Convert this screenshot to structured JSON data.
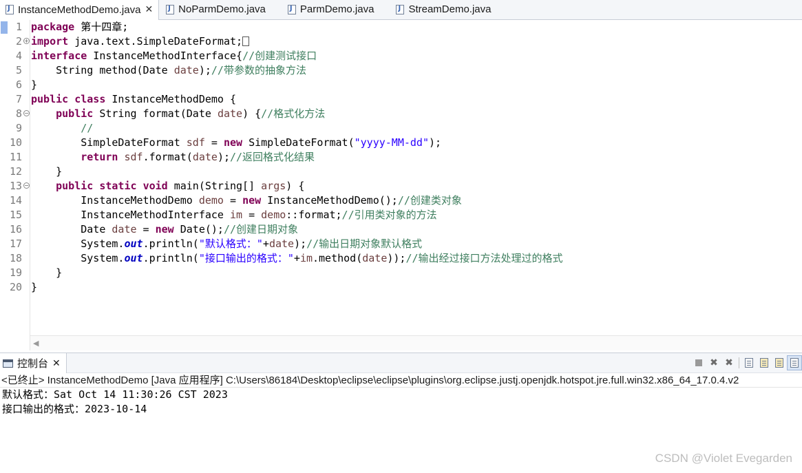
{
  "editor_tabs": [
    {
      "label": "InstanceMethodDemo.java",
      "active": true
    },
    {
      "label": "NoParmDemo.java",
      "active": false
    },
    {
      "label": "ParmDemo.java",
      "active": false
    },
    {
      "label": "StreamDemo.java",
      "active": false
    }
  ],
  "line_numbers": [
    "1",
    "2",
    "4",
    "5",
    "6",
    "7",
    "8",
    "9",
    "10",
    "11",
    "12",
    "13",
    "14",
    "15",
    "16",
    "17",
    "18",
    "19",
    "20"
  ],
  "code": {
    "l1": [
      "package",
      " 第十四章;"
    ],
    "l2": [
      "import",
      " java.text.SimpleDateFormat;"
    ],
    "l4": [
      "interface",
      " InstanceMethodInterface{",
      "//创建测试接口"
    ],
    "l5": [
      "    String method(Date ",
      "date",
      ");",
      "//带参数的抽象方法"
    ],
    "l6": [
      "}"
    ],
    "l7": [
      "public",
      " ",
      "class",
      " InstanceMethodDemo {"
    ],
    "l8": [
      "    ",
      "public",
      " String format(Date ",
      "date",
      ") {",
      "//格式化方法"
    ],
    "l9": [
      "        ",
      "//"
    ],
    "l10": [
      "        SimpleDateFormat ",
      "sdf",
      " = ",
      "new",
      " SimpleDateFormat(",
      "\"yyyy-MM-dd\"",
      ");"
    ],
    "l11": [
      "        ",
      "return",
      " ",
      "sdf",
      ".format(",
      "date",
      ");",
      "//返回格式化结果"
    ],
    "l12": [
      "    }"
    ],
    "l13": [
      "    ",
      "public",
      " ",
      "static",
      " ",
      "void",
      " main(String[] ",
      "args",
      ") {"
    ],
    "l14": [
      "        InstanceMethodDemo ",
      "demo",
      " = ",
      "new",
      " InstanceMethodDemo();",
      "//创建类对象"
    ],
    "l15": [
      "        InstanceMethodInterface ",
      "im",
      " = ",
      "demo",
      "::format;",
      "//引用类对象的方法"
    ],
    "l16": [
      "        Date ",
      "date",
      " = ",
      "new",
      " Date();",
      "//创建日期对象"
    ],
    "l17": [
      "        System.",
      "out",
      ".println(",
      "\"默认格式：\"",
      "+",
      "date",
      ");",
      "//输出日期对象默认格式"
    ],
    "l18": [
      "        System.",
      "out",
      ".println(",
      "\"接口输出的格式：\"",
      "+",
      "im",
      ".method(",
      "date",
      "));",
      "//输出经过接口方法处理过的格式"
    ],
    "l19": [
      "    }"
    ],
    "l20": [
      "}"
    ]
  },
  "console": {
    "tab_label": "控制台",
    "header": "<已终止> InstanceMethodDemo [Java 应用程序] C:\\Users\\86184\\Desktop\\eclipse\\eclipse\\plugins\\org.eclipse.justj.openjdk.hotspot.jre.full.win32.x86_64_17.0.4.v2",
    "output": [
      "默认格式：Sat Oct 14 11:30:26 CST 2023",
      "接口输出的格式：2023-10-14"
    ]
  },
  "watermark": "CSDN @Violet Evegarden",
  "colors": {
    "keyword": "#7f0055",
    "comment": "#3f7f5f",
    "string": "#2a00ff",
    "variable": "#6a3e3e",
    "field": "#0000c0"
  },
  "icons": {
    "editor_tab": "java-file-icon",
    "console_tab": "console-icon",
    "toolbar": [
      "terminate-icon",
      "remove-launch-icon",
      "remove-all-terminated-icon",
      "scroll-lock-icon",
      "word-wrap-icon",
      "show-console-icon",
      "pin-console-icon"
    ]
  }
}
